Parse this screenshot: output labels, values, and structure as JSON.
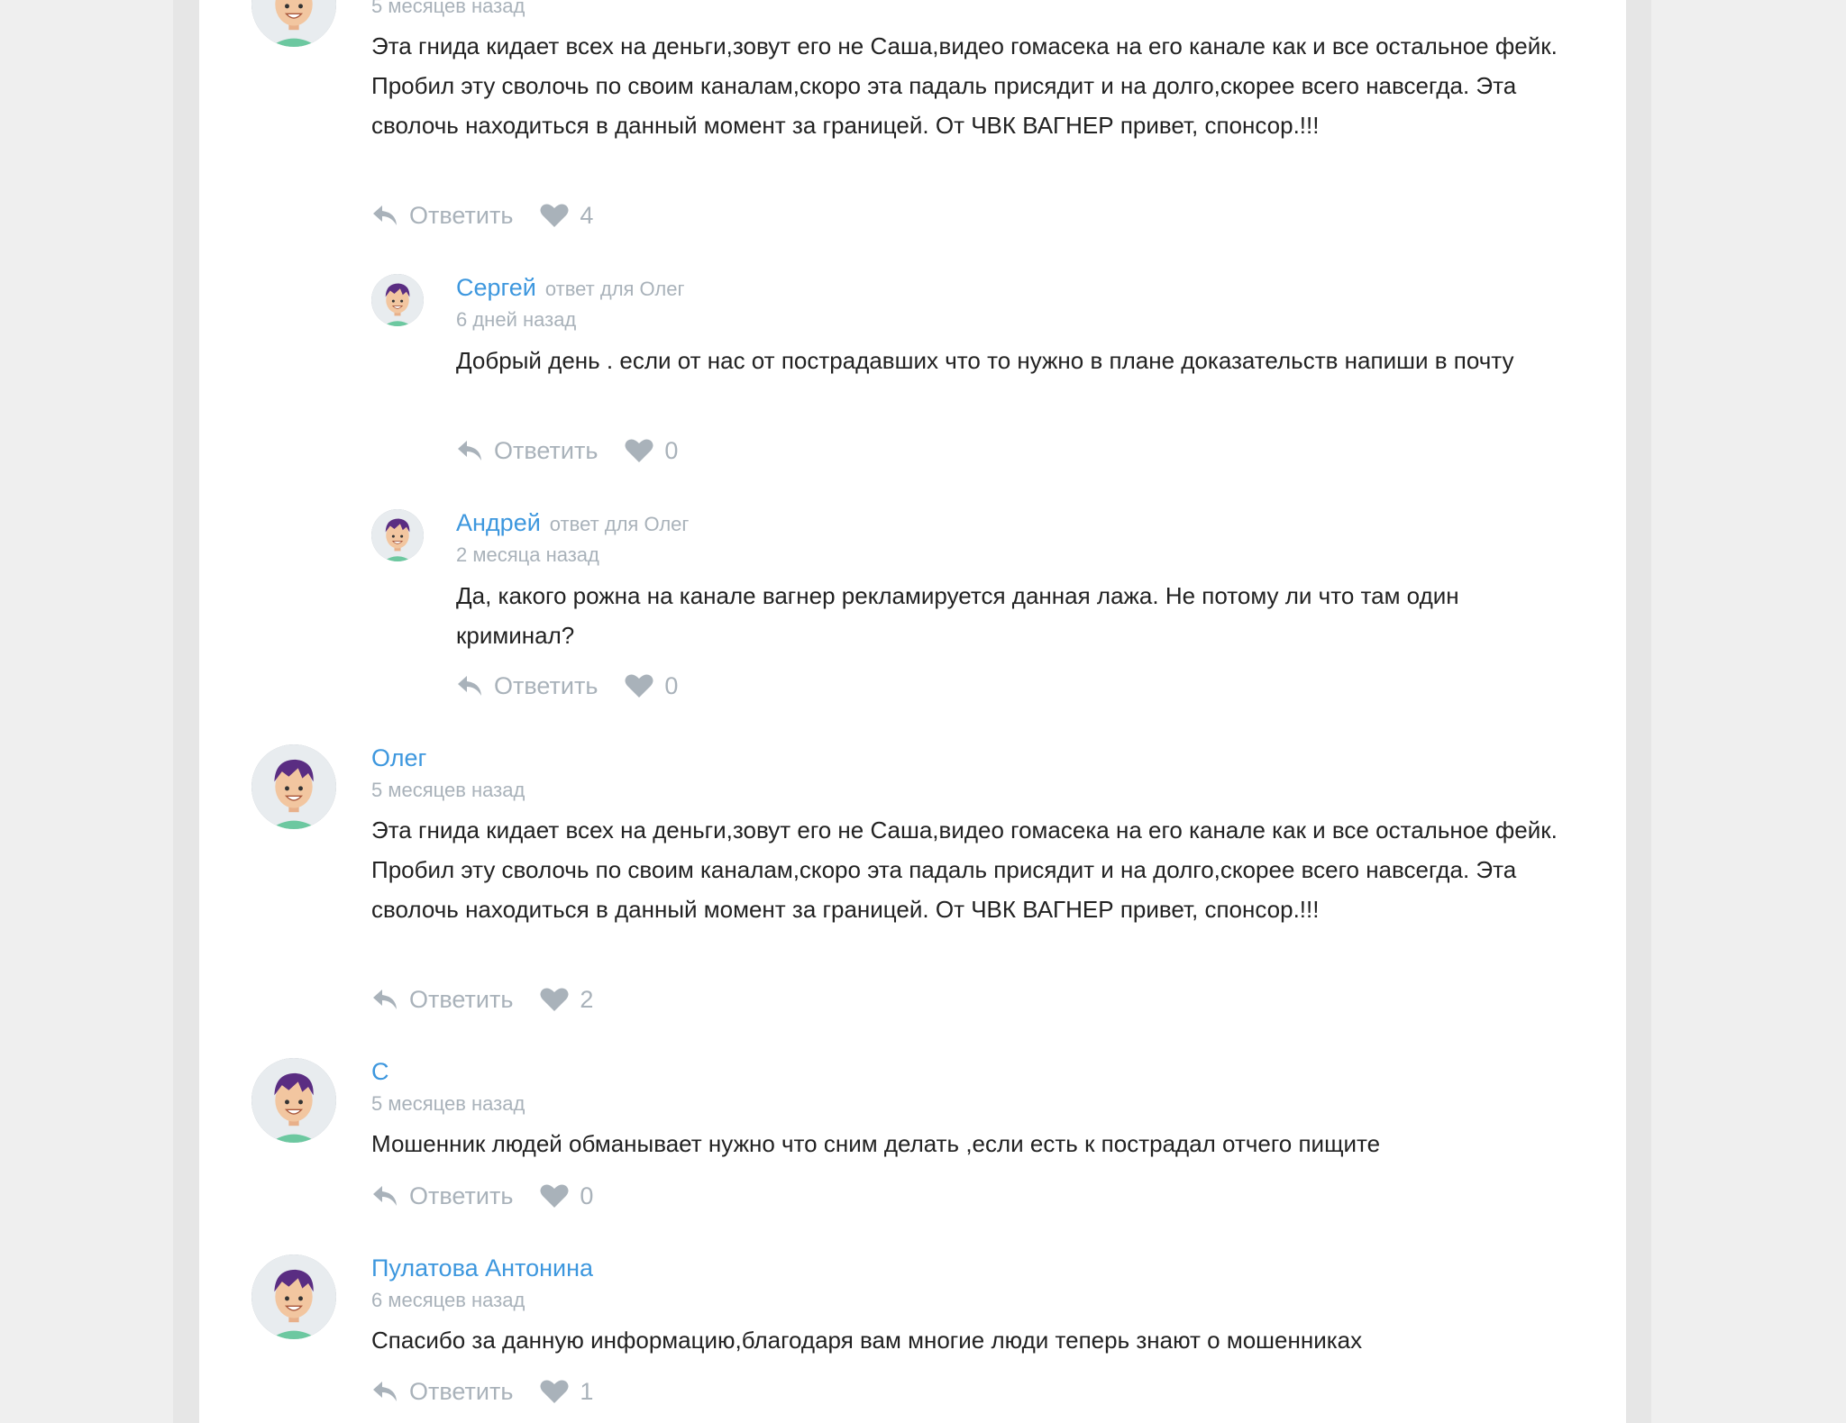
{
  "ui": {
    "reply_label": "Ответить",
    "reply_prefix": "ответ для"
  },
  "colors": {
    "author": "#3d97de",
    "muted": "#a9b2ba",
    "avatar_hair": "#5a2d82",
    "avatar_face": "#f2c6a0",
    "avatar_shirt": "#6cc8a0"
  },
  "comments": [
    {
      "date": "5 месяцев назад",
      "text": "Эта гнида кидает всех на деньги,зовут его не Саша,видео гомасека на его канале как и все остальное фейк. Пробил эту сволочь по своим каналам,скоро эта падаль присядит и на долго,скорее всего навсегда. Эта сволочь находиться в данный момент за границей. От ЧВК ВАГНЕР привет, спонсор.!!!",
      "likes": "4"
    },
    {
      "author": "Сергей",
      "reply_to": "ответ для Олег",
      "date": "6 дней назад",
      "text": "Добрый день . если от нас от пострадавших что то нужно в плане доказательств напиши в почту",
      "likes": "0"
    },
    {
      "author": "Андрей",
      "reply_to": "ответ для Олег",
      "date": "2 месяца назад",
      "text": "Да, какого рожна на канале вагнер рекламируется данная лажа. Не потому ли что там один криминал?",
      "likes": "0"
    },
    {
      "author": "Олег",
      "date": "5 месяцев назад",
      "text": "Эта гнида кидает всех на деньги,зовут его не Саша,видео гомасека на его канале как и все остальное фейк. Пробил эту сволочь по своим каналам,скоро эта падаль присядит и на долго,скорее всего навсегда. Эта сволочь находиться в данный момент за границей. От ЧВК ВАГНЕР привет, спонсор.!!!",
      "likes": "2"
    },
    {
      "author": "С",
      "date": "5 месяцев назад",
      "text": "Мошенник людей обманывает нужно что сним делать ,если есть к пострадал отчего пищите",
      "likes": "0"
    },
    {
      "author": "Пулатова Антонина",
      "date": "6 месяцев назад",
      "text": "Спасибо за данную информацию,благодаря вам многие люди теперь знают о мошенниках",
      "likes": "1"
    }
  ]
}
